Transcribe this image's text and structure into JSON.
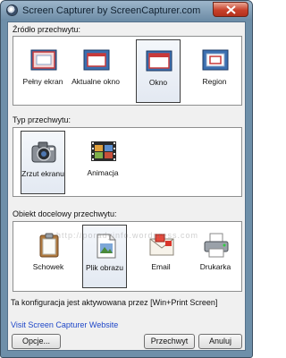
{
  "window": {
    "title": "Screen Capturer by ScreenCapturer.com"
  },
  "source": {
    "label": "Źródło przechwytu:",
    "options": [
      {
        "label": "Pełny ekran",
        "icon": "full-screen-icon"
      },
      {
        "label": "Aktualne okno",
        "icon": "current-window-icon"
      },
      {
        "label": "Okno",
        "icon": "window-icon",
        "selected": true
      },
      {
        "label": "Region",
        "icon": "region-icon"
      }
    ]
  },
  "type": {
    "label": "Typ przechwytu:",
    "options": [
      {
        "label": "Zrzut ekranu",
        "icon": "camera-icon",
        "selected": true
      },
      {
        "label": "Animacja",
        "icon": "film-icon"
      }
    ]
  },
  "target": {
    "label": "Obiekt docelowy przechwytu:",
    "options": [
      {
        "label": "Schowek",
        "icon": "clipboard-icon"
      },
      {
        "label": "Plik obrazu",
        "icon": "image-file-icon",
        "selected": true
      },
      {
        "label": "Email",
        "icon": "email-icon"
      },
      {
        "label": "Drukarka",
        "icon": "printer-icon"
      }
    ]
  },
  "watermark": "http://poradyinfo.wordpress.com",
  "status": "Ta konfiguracja jest aktywowana przez [Win+Print Screen]",
  "link": "Visit Screen Capturer Website",
  "buttons": {
    "options": "Opcje...",
    "capture": "Przechwyt",
    "cancel": "Anuluj"
  }
}
